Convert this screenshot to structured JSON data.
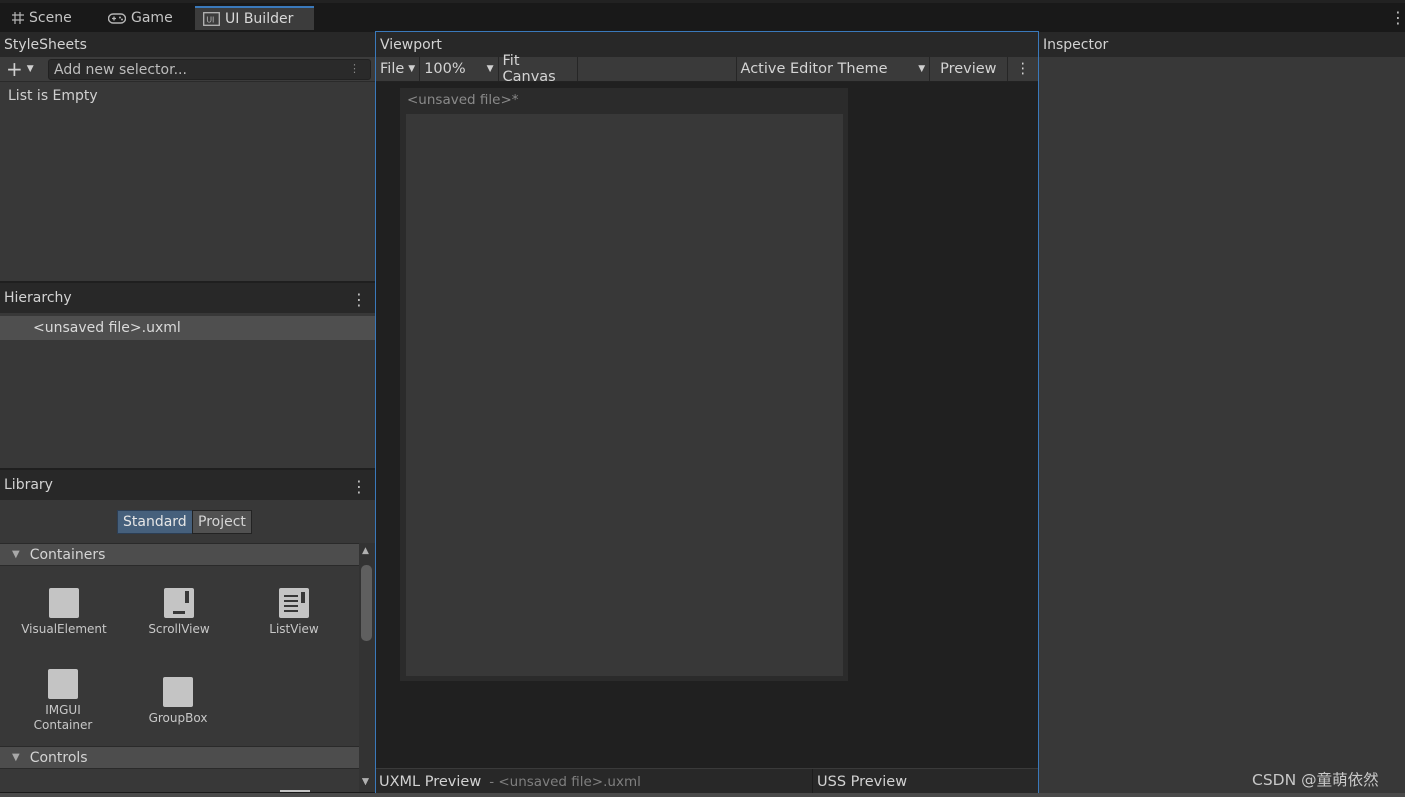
{
  "window_tabs": [
    {
      "label": "Scene",
      "icon": "grid-icon"
    },
    {
      "label": "Game",
      "icon": "gamepad-icon"
    },
    {
      "label": "UI Builder",
      "icon": "ui-builder-icon",
      "active": true
    }
  ],
  "stylesheets": {
    "title": "StyleSheets",
    "add_selector_placeholder": "Add new selector...",
    "empty_message": "List is Empty"
  },
  "hierarchy": {
    "title": "Hierarchy",
    "items": [
      "<unsaved file>.uxml"
    ]
  },
  "library": {
    "title": "Library",
    "tabs": [
      {
        "label": "Standard",
        "selected": true
      },
      {
        "label": "Project",
        "selected": false
      }
    ],
    "sections": [
      {
        "label": "Containers",
        "items": [
          {
            "label": "VisualElement",
            "icon": "visual-element-icon"
          },
          {
            "label": "ScrollView",
            "icon": "scroll-view-icon"
          },
          {
            "label": "ListView",
            "icon": "list-view-icon"
          },
          {
            "label": "IMGUI\nContainer",
            "icon": "imgui-container-icon"
          },
          {
            "label": "GroupBox",
            "icon": "group-box-icon"
          }
        ]
      },
      {
        "label": "Controls",
        "items": []
      }
    ]
  },
  "viewport": {
    "title": "Viewport",
    "toolbar": {
      "file_label": "File",
      "zoom": "100%",
      "fit_canvas_label": "Fit Canvas",
      "theme_selected": "Active Editor Theme",
      "preview_label": "Preview"
    },
    "canvas_title": "<unsaved file>*"
  },
  "uxml_preview": {
    "title": "UXML Preview",
    "subtitle": "- <unsaved file>.uxml"
  },
  "uss_preview": {
    "title": "USS Preview"
  },
  "inspector": {
    "title": "Inspector"
  },
  "watermark": "CSDN @童萌依然",
  "colors": {
    "accent": "#3a79bb",
    "selected_toggle": "#46607c",
    "panel_bg": "#383838",
    "header_bg": "#282828"
  }
}
